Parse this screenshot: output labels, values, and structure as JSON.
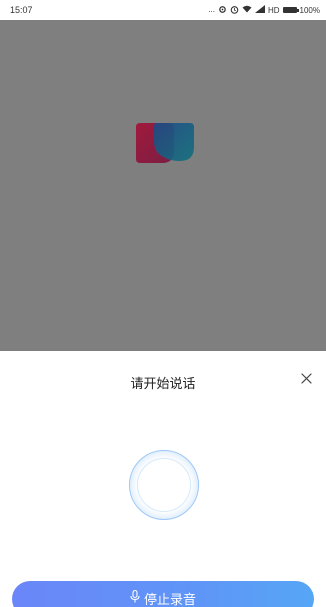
{
  "status_bar": {
    "time": "15:07",
    "signal_dots": "...",
    "network": "HD",
    "battery": "100%"
  },
  "sheet": {
    "title": "请开始说话",
    "close_icon": "close-icon",
    "stop_button_label": "停止录音",
    "mic_icon": "microphone-icon"
  },
  "colors": {
    "overlay": "#7f7f7f",
    "accent_start": "#6a86f8",
    "accent_end": "#56a6f6",
    "ring": "#9cc8f6"
  }
}
